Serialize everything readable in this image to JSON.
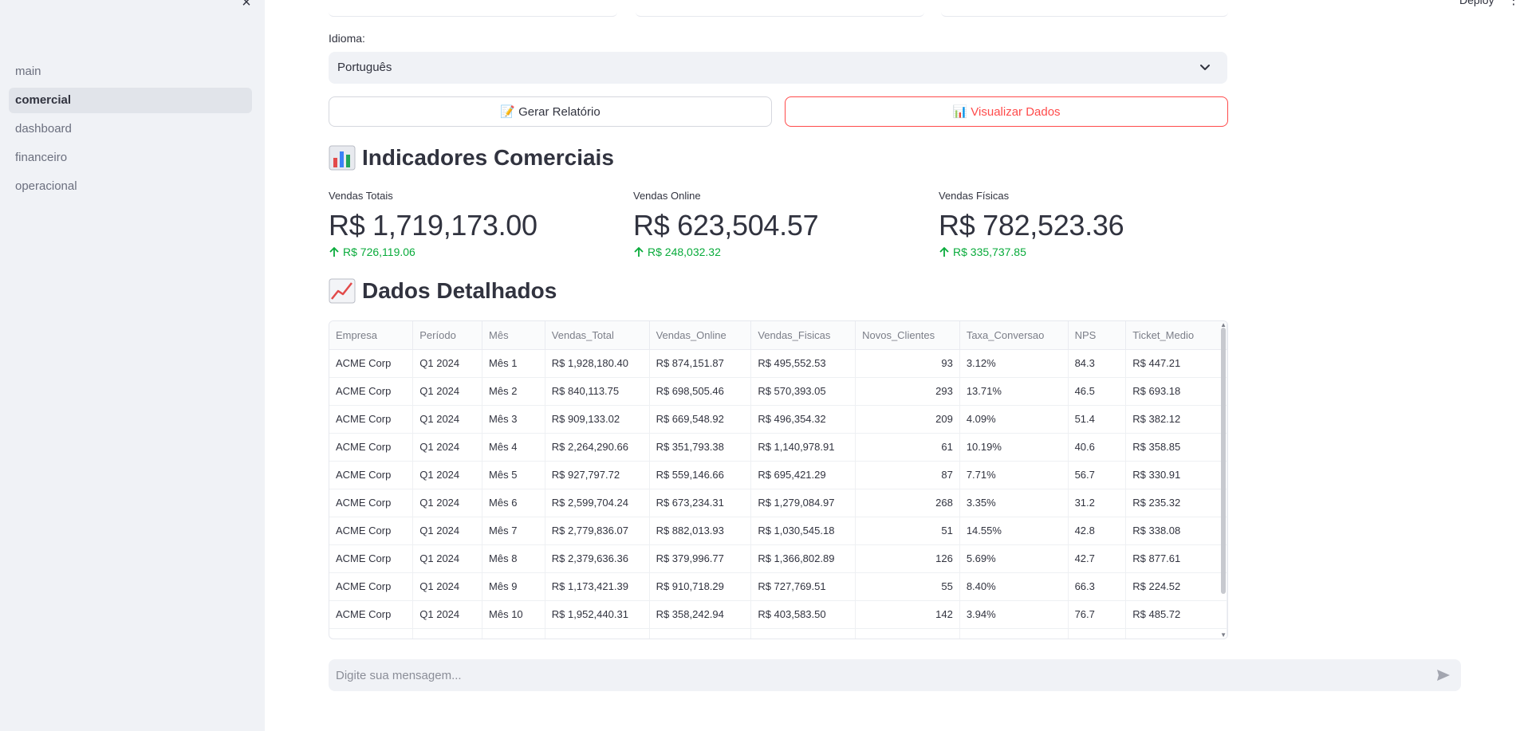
{
  "sidebar": {
    "close_symbol": "×",
    "items": [
      {
        "label": "main",
        "active": false
      },
      {
        "label": "comercial",
        "active": true
      },
      {
        "label": "dashboard",
        "active": false
      },
      {
        "label": "financeiro",
        "active": false
      },
      {
        "label": "operacional",
        "active": false
      }
    ]
  },
  "header": {
    "deploy_label": "Deploy",
    "menu_symbol": "⋮"
  },
  "language": {
    "label": "Idioma:",
    "selected": "Português"
  },
  "buttons": {
    "generate_report": "📝 Gerar Relatório",
    "view_data": "📊 Visualizar Dados"
  },
  "indicators": {
    "title": "Indicadores Comerciais",
    "icon": "bar-chart-emoji",
    "metrics": [
      {
        "label": "Vendas Totais",
        "value": "R$ 1,719,173.00",
        "delta": "R$ 726,119.06",
        "direction": "up"
      },
      {
        "label": "Vendas Online",
        "value": "R$ 623,504.57",
        "delta": "R$ 248,032.32",
        "direction": "up"
      },
      {
        "label": "Vendas Físicas",
        "value": "R$ 782,523.36",
        "delta": "R$ 335,737.85",
        "direction": "up"
      }
    ]
  },
  "details": {
    "title": "Dados Detalhados",
    "icon": "line-chart-emoji",
    "columns": [
      "Empresa",
      "Período",
      "Mês",
      "Vendas_Total",
      "Vendas_Online",
      "Vendas_Fisicas",
      "Novos_Clientes",
      "Taxa_Conversao",
      "NPS",
      "Ticket_Medio"
    ],
    "rows": [
      [
        "ACME Corp",
        "Q1 2024",
        "Mês 1",
        "R$ 1,928,180.40",
        "R$ 874,151.87",
        "R$ 495,552.53",
        "93",
        "3.12%",
        "84.3",
        "R$ 447.21"
      ],
      [
        "ACME Corp",
        "Q1 2024",
        "Mês 2",
        "R$ 840,113.75",
        "R$ 698,505.46",
        "R$ 570,393.05",
        "293",
        "13.71%",
        "46.5",
        "R$ 693.18"
      ],
      [
        "ACME Corp",
        "Q1 2024",
        "Mês 3",
        "R$ 909,133.02",
        "R$ 669,548.92",
        "R$ 496,354.32",
        "209",
        "4.09%",
        "51.4",
        "R$ 382.12"
      ],
      [
        "ACME Corp",
        "Q1 2024",
        "Mês 4",
        "R$ 2,264,290.66",
        "R$ 351,793.38",
        "R$ 1,140,978.91",
        "61",
        "10.19%",
        "40.6",
        "R$ 358.85"
      ],
      [
        "ACME Corp",
        "Q1 2024",
        "Mês 5",
        "R$ 927,797.72",
        "R$ 559,146.66",
        "R$ 695,421.29",
        "87",
        "7.71%",
        "56.7",
        "R$ 330.91"
      ],
      [
        "ACME Corp",
        "Q1 2024",
        "Mês 6",
        "R$ 2,599,704.24",
        "R$ 673,234.31",
        "R$ 1,279,084.97",
        "268",
        "3.35%",
        "31.2",
        "R$ 235.32"
      ],
      [
        "ACME Corp",
        "Q1 2024",
        "Mês 7",
        "R$ 2,779,836.07",
        "R$ 882,013.93",
        "R$ 1,030,545.18",
        "51",
        "14.55%",
        "42.8",
        "R$ 338.08"
      ],
      [
        "ACME Corp",
        "Q1 2024",
        "Mês 8",
        "R$ 2,379,636.36",
        "R$ 379,996.77",
        "R$ 1,366,802.89",
        "126",
        "5.69%",
        "42.7",
        "R$ 877.61"
      ],
      [
        "ACME Corp",
        "Q1 2024",
        "Mês 9",
        "R$ 1,173,421.39",
        "R$ 910,718.29",
        "R$ 727,769.51",
        "55",
        "8.40%",
        "66.3",
        "R$ 224.52"
      ],
      [
        "ACME Corp",
        "Q1 2024",
        "Mês 10",
        "R$ 1,952,440.31",
        "R$ 358,242.94",
        "R$ 403,583.50",
        "142",
        "3.94%",
        "76.7",
        "R$ 485.72"
      ],
      [
        "",
        "",
        "",
        "",
        "",
        "",
        "",
        "",
        "",
        ""
      ]
    ]
  },
  "chat": {
    "placeholder": "Digite sua mensagem..."
  },
  "colors": {
    "accent": "#ff4b4b",
    "positive": "#09ab3b",
    "sidebar_bg": "#f0f2f6"
  }
}
